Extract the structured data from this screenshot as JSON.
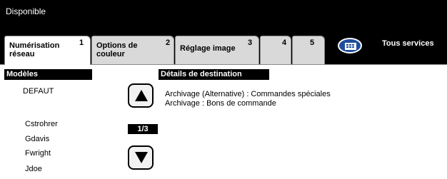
{
  "status": {
    "text": "Disponible"
  },
  "tabs": [
    {
      "label_line1": "Numérisation",
      "label_line2": "réseau",
      "number": "1"
    },
    {
      "label_line1": "Options de",
      "label_line2": "couleur",
      "number": "2"
    },
    {
      "label_line1": "Réglage image",
      "label_line2": "",
      "number": "3"
    },
    {
      "number": "4"
    },
    {
      "number": "5"
    }
  ],
  "all_services": {
    "label": "Tous services",
    "icon": "all-services-icon"
  },
  "templates": {
    "header": "Modèles",
    "items": [
      "DEFAUT",
      "Cstrohrer",
      "Gdavis",
      "Fwright",
      "Jdoe"
    ],
    "page_indicator": "1/3"
  },
  "destination": {
    "header": "Détails de destination",
    "lines": [
      "Archivage (Alternative) : Commandes spéciales",
      "Archivage : Bons de commande"
    ]
  },
  "colors": {
    "accent": "#1f4c9c",
    "bar": "#000000",
    "tab": "#d9d9d9"
  }
}
